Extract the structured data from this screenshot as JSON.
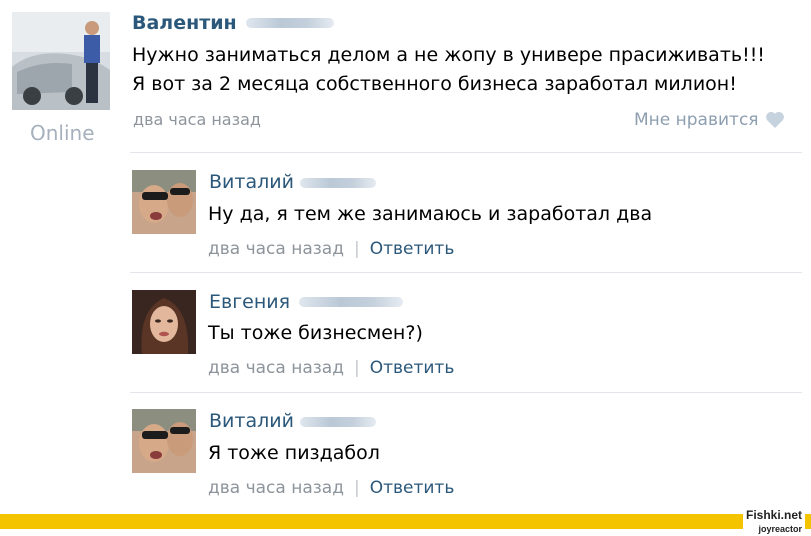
{
  "post": {
    "author": "Валентин",
    "status": "Online",
    "lines": [
      "Нужно заниматься делом а не жопу в универе прасиживать!!!",
      "Я вот за 2 месяца собственного бизнеса заработал милион!"
    ],
    "time": "два часа назад",
    "like_label": "Мне нравится"
  },
  "comments": [
    {
      "author": "Виталий",
      "text": "Ну да, я тем же занимаюсь и заработал два",
      "time": "два часа назад",
      "reply": "Ответить"
    },
    {
      "author": "Евгения",
      "text": "Ты тоже бизнесмен?)",
      "time": "два часа назад",
      "reply": "Ответить"
    },
    {
      "author": "Виталий",
      "text": "Я тоже пиздабол",
      "time": "два часа назад",
      "reply": "Ответить"
    }
  ],
  "watermark": {
    "site": "Fishki.net",
    "site2": "joyreactor"
  },
  "colors": {
    "link": "#2b587a",
    "meta": "#8d949b",
    "band": "#f5c400"
  }
}
